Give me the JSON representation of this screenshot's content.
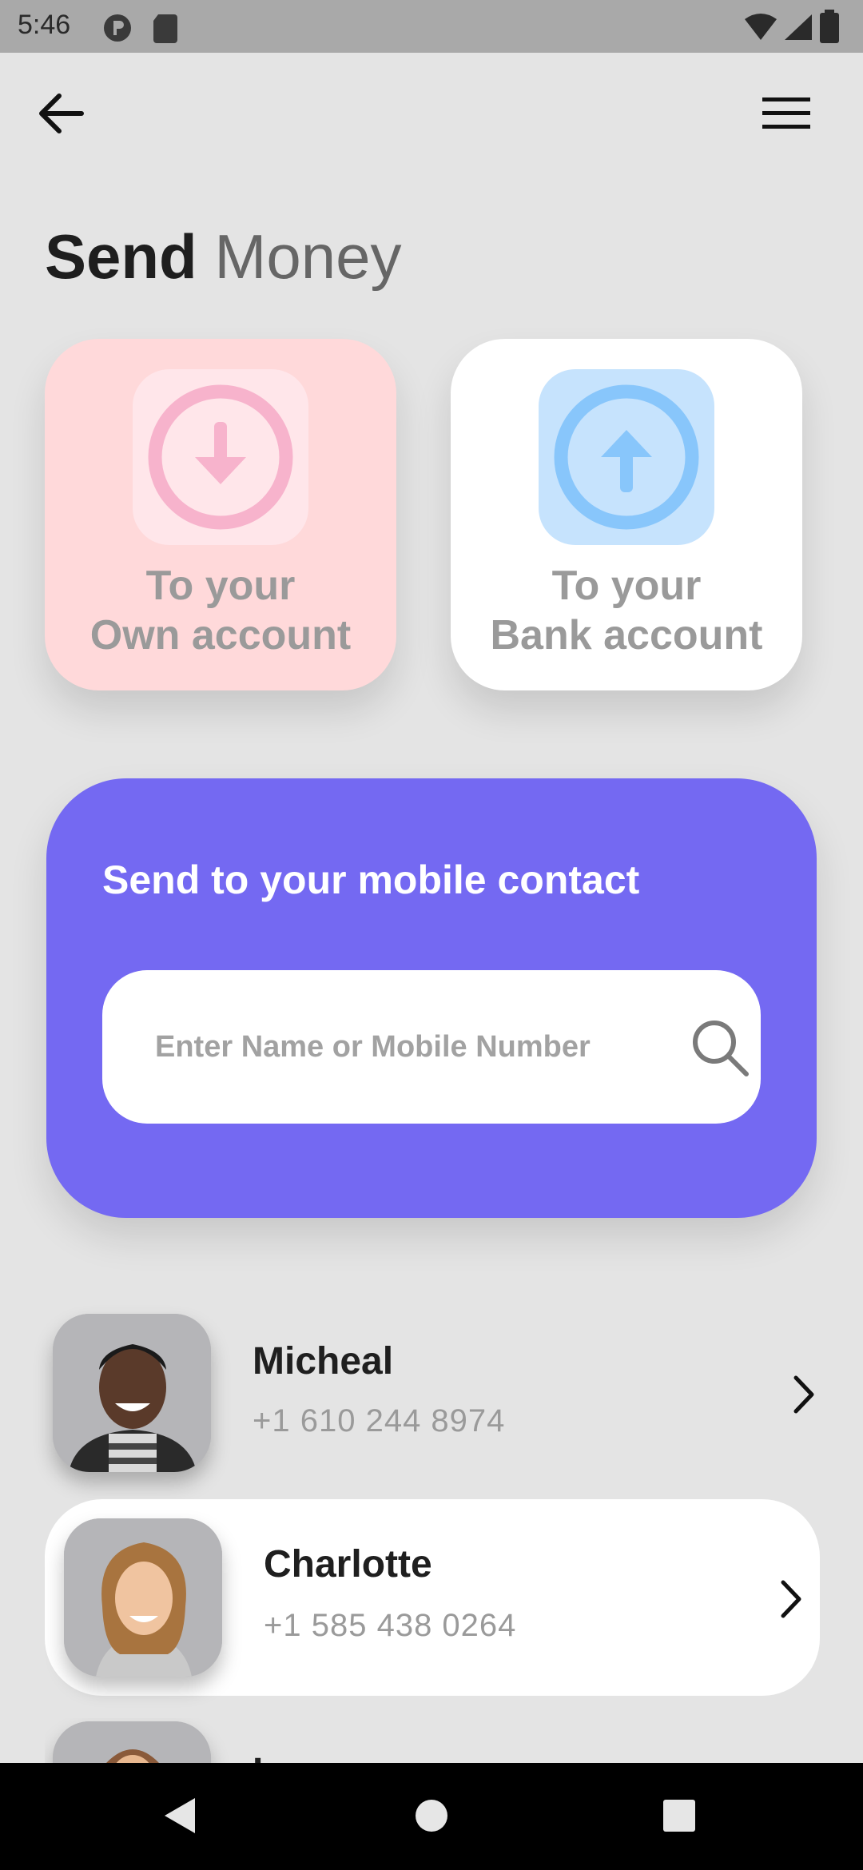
{
  "status_bar": {
    "time": "5:46"
  },
  "header": {
    "title_bold": "Send",
    "title_light": "Money"
  },
  "options": [
    {
      "line1": "To your",
      "line2": "Own account"
    },
    {
      "line1": "To your",
      "line2": "Bank account"
    }
  ],
  "contact_panel": {
    "title": "Send to your mobile contact",
    "search_placeholder": "Enter Name or Mobile Number"
  },
  "contacts": [
    {
      "name": "Micheal",
      "phone": "+1 610 244 8974"
    },
    {
      "name": "Charlotte",
      "phone": "+1 585 438 0264"
    },
    {
      "name": "Laura",
      "phone": ""
    }
  ],
  "colors": {
    "panel": "#7469f2",
    "own_card": "#ffd9da",
    "own_icon": "#f7b3cc",
    "bank_icon": "#88c6fb"
  }
}
